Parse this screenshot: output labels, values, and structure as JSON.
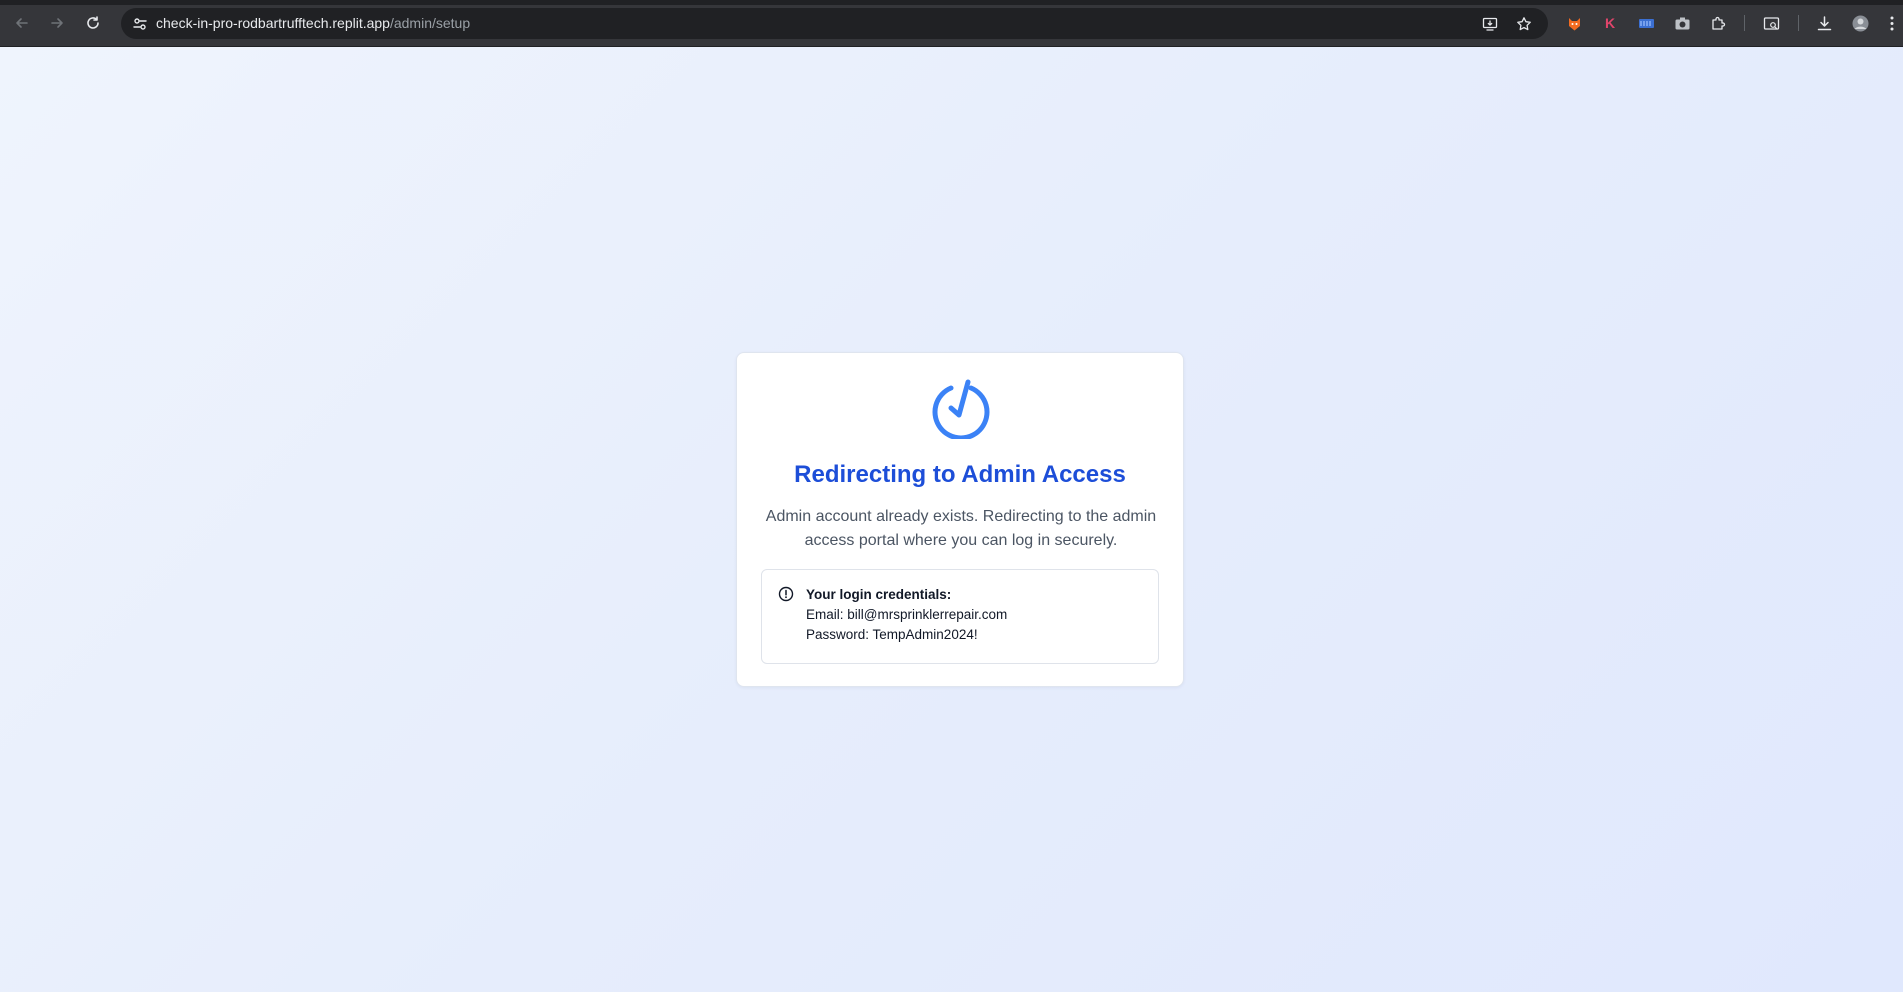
{
  "browser": {
    "url_host": "check-in-pro-rodbartrufftech.replit.app",
    "url_path": "/admin/setup",
    "extension_k_label": "K"
  },
  "card": {
    "title": "Redirecting to Admin Access",
    "description": "Admin account already exists. Redirecting to the admin access portal where you can log in securely.",
    "alert": {
      "heading": "Your login credentials:",
      "email_line": "Email: bill@mrsprinklerrepair.com",
      "password_line": "Password: TempAdmin2024!"
    }
  },
  "colors": {
    "accent": "#1d4ed8",
    "icon_blue": "#3b82f6",
    "page_bg": "#e8eefc"
  }
}
